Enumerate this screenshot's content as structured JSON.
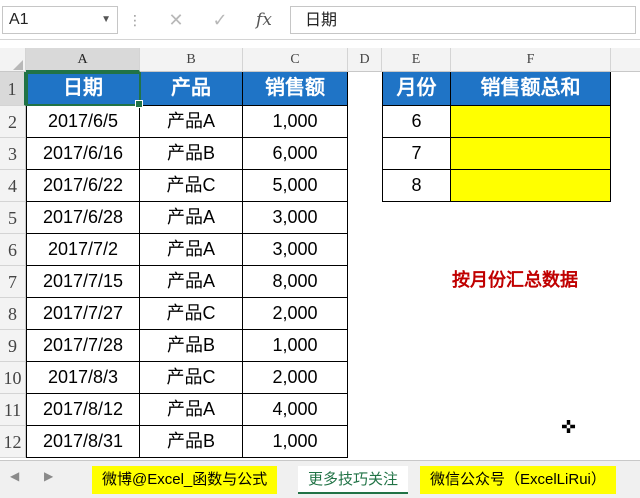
{
  "formula_bar": {
    "cell_ref": "A1",
    "content": "日期",
    "cancel_icon": "✕",
    "enter_icon": "✓",
    "fx_icon": "fx"
  },
  "columns": [
    "A",
    "B",
    "C",
    "D",
    "E",
    "F"
  ],
  "rows": [
    "1",
    "2",
    "3",
    "4",
    "5",
    "6",
    "7",
    "8",
    "9",
    "10",
    "11",
    "12"
  ],
  "table1": {
    "headers": [
      "日期",
      "产品",
      "销售额"
    ],
    "rows": [
      [
        "2017/6/5",
        "产品A",
        "1,000"
      ],
      [
        "2017/6/16",
        "产品B",
        "6,000"
      ],
      [
        "2017/6/22",
        "产品C",
        "5,000"
      ],
      [
        "2017/6/28",
        "产品A",
        "3,000"
      ],
      [
        "2017/7/2",
        "产品A",
        "3,000"
      ],
      [
        "2017/7/15",
        "产品A",
        "8,000"
      ],
      [
        "2017/7/27",
        "产品C",
        "2,000"
      ],
      [
        "2017/7/28",
        "产品B",
        "1,000"
      ],
      [
        "2017/8/3",
        "产品C",
        "2,000"
      ],
      [
        "2017/8/12",
        "产品A",
        "4,000"
      ],
      [
        "2017/8/31",
        "产品B",
        "1,000"
      ]
    ]
  },
  "table2": {
    "headers": [
      "月份",
      "销售额总和"
    ],
    "rows": [
      [
        "6",
        ""
      ],
      [
        "7",
        ""
      ],
      [
        "8",
        ""
      ]
    ]
  },
  "note": "按月份汇总数据",
  "sheet_tabs": [
    {
      "label": "微博@Excel_函数与公式",
      "active": false
    },
    {
      "label": "更多技巧关注",
      "active": true
    },
    {
      "label": "微信公众号（ExcelLiRui）",
      "active": false
    }
  ],
  "colors": {
    "header_blue": "#1f74c6",
    "highlight_yellow": "#ffff00",
    "note_red": "#c00000",
    "excel_green": "#217346"
  }
}
